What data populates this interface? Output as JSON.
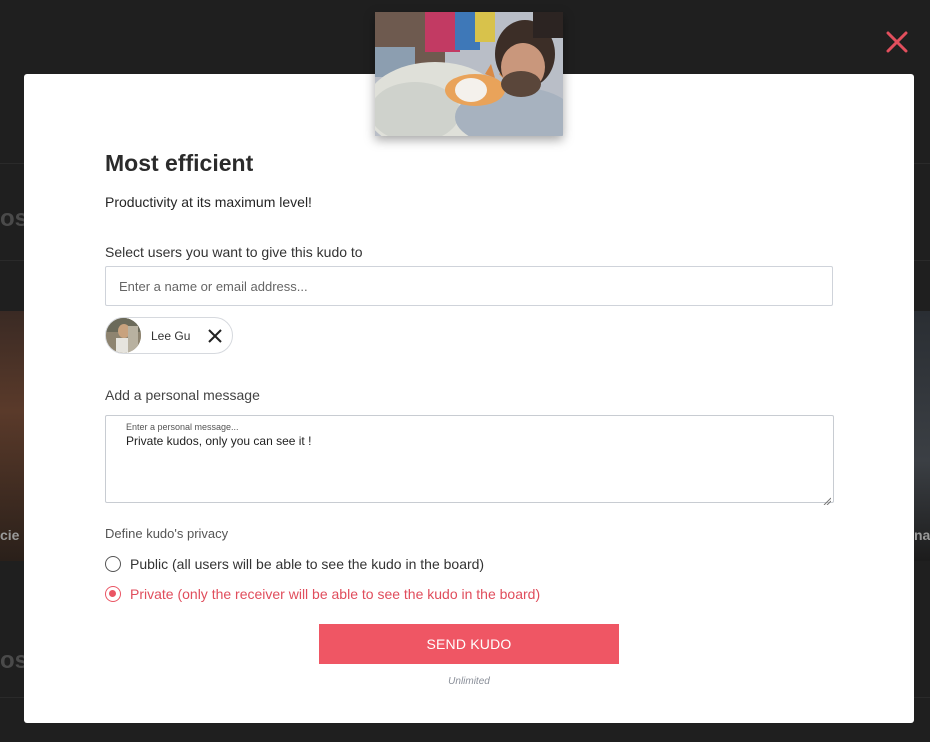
{
  "background": {
    "partial_texts": [
      "os",
      "cie",
      "na",
      "os"
    ]
  },
  "close": {
    "icon": "close-icon",
    "color": "#e24f5d"
  },
  "modal": {
    "hero_image": "man-sleeping-with-cat-photo",
    "title": "Most efficient",
    "subtitle": "Productivity at its maximum level!"
  },
  "users": {
    "label": "Select users you want to give this kudo to",
    "placeholder": "Enter a name or email address...",
    "value": "",
    "selected": [
      {
        "name": "Lee Gu",
        "icon": "close-icon"
      }
    ]
  },
  "message": {
    "label": "Add a personal message",
    "placeholder": "Enter a personal message...",
    "value": "Private kudos, only you can see it !"
  },
  "privacy": {
    "label": "Define kudo's privacy",
    "options": [
      {
        "label": "Public (all users will be able to see the kudo in the board)",
        "checked": false
      },
      {
        "label": "Private (only the receiver will be able to see the kudo in the board)",
        "checked": true
      }
    ]
  },
  "send": {
    "label": "SEND KUDO",
    "limit": "Unlimited",
    "color": "#ef5664"
  }
}
